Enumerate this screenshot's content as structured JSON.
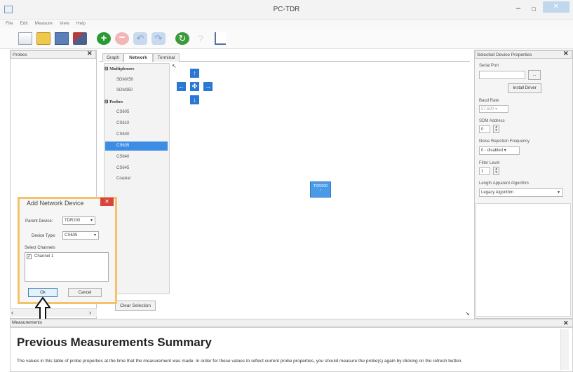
{
  "window": {
    "title": "PC-TDR",
    "min_glyph": "–",
    "max_glyph": "□",
    "close_glyph": "✕"
  },
  "menu": [
    "File",
    "Edit",
    "Measure",
    "View",
    "Help"
  ],
  "toolbar_icons": [
    "new-file-icon",
    "open-folder-icon",
    "save-icon",
    "tool-icon",
    "add-icon",
    "remove-icon",
    "undo-icon",
    "redo-icon",
    "refresh-icon",
    "help-icon",
    "chart-icon"
  ],
  "probes_panel": {
    "title": "Probes",
    "close": "✕",
    "scroll_right": "›",
    "scroll_left": "‹"
  },
  "network": {
    "tabs": [
      "Graph",
      "Network",
      "Terminal"
    ],
    "active_tab": "Network",
    "groups": [
      {
        "label": "Multiplexers",
        "items": [
          "SDMX50",
          "SDM350"
        ]
      },
      {
        "label": "Probes",
        "items": [
          "CS605",
          "CS610",
          "CS630",
          "CS635",
          "CS640",
          "CS645",
          "Coaxial"
        ]
      }
    ],
    "selected_item": "CS635",
    "node_label": "TDR200",
    "clear_selection": "Clear Selection"
  },
  "properties": {
    "title": "Selected Device Properties",
    "serial_port_label": "Serial Port",
    "browse_label": "...",
    "install_driver": "Install Driver",
    "baud_rate_label": "Baud Rate",
    "baud_rate_value": "57,600",
    "sdm_address_label": "SDM Address",
    "sdm_address_value": "0",
    "noise_label": "Noise Rejection Frequency",
    "noise_value": "0 - disabled",
    "filter_label": "Filter Level",
    "filter_value": "1",
    "length_label": "Length Apparent Algorithm",
    "length_value": "Legacy Algorithm"
  },
  "dialog": {
    "title": "Add Network Device",
    "close": "✕",
    "parent_label": "Parent Device:",
    "parent_value": "TDR200",
    "type_label": "Device Type:",
    "type_value": "CS635",
    "channels_label": "Select Channels",
    "channel_item": "Channel 1",
    "ok": "Ok",
    "cancel": "Cancel"
  },
  "measurements": {
    "header": "Measurements",
    "title": "Previous Measurements Summary",
    "description": "The values in this table of probe properties at the time that the measurement was made. In order for these values to reflect current probe properties, you should measure the probe(s) again by clicking on the refresh button.",
    "close": "✕"
  },
  "colors": {
    "accent": "#2b78d4",
    "dialog_border": "#f3c26a",
    "selected": "#3d8de4"
  }
}
